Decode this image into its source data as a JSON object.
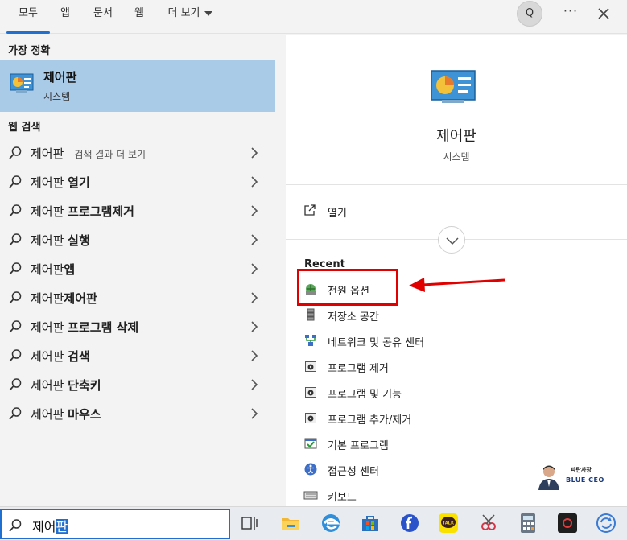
{
  "tabs": [
    {
      "label": "모두",
      "active": true
    },
    {
      "label": "앱"
    },
    {
      "label": "문서"
    },
    {
      "label": "웹"
    },
    {
      "label": "더 보기"
    }
  ],
  "header": {
    "avatar_letter": "Q",
    "more_label": "···"
  },
  "left": {
    "best_match_label": "가장 정확",
    "best_match": {
      "title": "제어판",
      "subtitle": "시스템"
    },
    "web_label": "웹 검색",
    "web_results": [
      {
        "text": "제어판",
        "bold": "",
        "hint": "- 검색 결과 더 보기"
      },
      {
        "text": "제어판 ",
        "bold": "열기"
      },
      {
        "text": "제어판 ",
        "bold": "프로그램제거"
      },
      {
        "text": "제어판 ",
        "bold": "실행"
      },
      {
        "text": "제어판",
        "bold": "앱"
      },
      {
        "text": "제어판",
        "bold": "제어판"
      },
      {
        "text": "제어판 ",
        "bold": "프로그램 삭제"
      },
      {
        "text": "제어판 ",
        "bold": "검색"
      },
      {
        "text": "제어판 ",
        "bold": "단축키"
      },
      {
        "text": "제어판 ",
        "bold": "마우스"
      }
    ]
  },
  "right": {
    "title": "제어판",
    "subtitle": "시스템",
    "open_label": "열기",
    "recent_label": "Recent",
    "recent_items": [
      {
        "label": "전원 옵션",
        "icon": "power-options-icon"
      },
      {
        "label": "저장소 공간",
        "icon": "storage-icon"
      },
      {
        "label": "네트워크 및 공유 센터",
        "icon": "network-icon"
      },
      {
        "label": "프로그램 제거",
        "icon": "programs-icon"
      },
      {
        "label": "프로그램 및 기능",
        "icon": "programs-icon"
      },
      {
        "label": "프로그램 추가/제거",
        "icon": "programs-icon"
      },
      {
        "label": "기본 프로그램",
        "icon": "default-programs-icon"
      },
      {
        "label": "접근성 센터",
        "icon": "accessibility-icon"
      },
      {
        "label": "키보드",
        "icon": "keyboard-icon"
      }
    ]
  },
  "watermark": {
    "line1": "파란사장",
    "line2": "BLUE CEO"
  },
  "search": {
    "typed": "제어",
    "selected": "판"
  },
  "colors": {
    "accent": "#1f6fd1",
    "highlight": "#a9cbe8",
    "annotation": "#e00000"
  }
}
